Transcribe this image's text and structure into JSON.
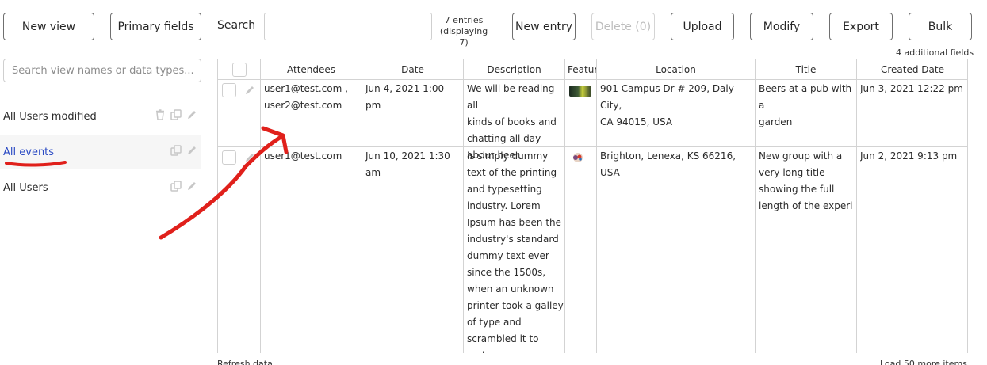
{
  "toolbar": {
    "new_view": "New view",
    "primary_fields": "Primary fields",
    "search_label": "Search",
    "search_value": "",
    "entries_line1": "7 entries",
    "entries_line2": "(displaying 7)",
    "new_entry": "New entry",
    "delete": "Delete (0)",
    "upload": "Upload",
    "modify": "Modify",
    "export": "Export",
    "bulk": "Bulk"
  },
  "sidebar": {
    "search_placeholder": "Search view names or data types...",
    "views": [
      {
        "label": "All Users modified",
        "icons": [
          "trash-icon",
          "copy-icon",
          "pencil-icon"
        ]
      },
      {
        "label": "All events",
        "icons": [
          "copy-icon",
          "pencil-icon"
        ],
        "active": true
      },
      {
        "label": "All Users",
        "icons": [
          "copy-icon",
          "pencil-icon"
        ]
      }
    ]
  },
  "additional_fields": "4 additional fields",
  "table": {
    "columns": [
      "Attendees",
      "Date",
      "Description",
      "Featur",
      "Location",
      "Title",
      "Created Date"
    ],
    "rows": [
      {
        "attendees": [
          "user1@test.com ,",
          "user2@test.com"
        ],
        "date": "Jun 4, 2021 1:00 pm",
        "description": [
          "We will be reading all",
          "kinds of books and",
          "chatting all day",
          "about beer."
        ],
        "location": [
          "901 Campus Dr # 209, Daly City,",
          "CA 94015, USA"
        ],
        "title": [
          "Beers at a pub with a",
          "garden"
        ],
        "created": "Jun 3, 2021 12:22 pm"
      },
      {
        "attendees": [
          "user1@test.com"
        ],
        "date": "Jun 10, 2021 1:30 am",
        "description": [
          "is simply dummy",
          "text of the printing",
          "and typesetting",
          "industry. Lorem",
          "Ipsum has been the",
          "industry's standard",
          "dummy text ever",
          "since the 1500s,",
          "when an unknown",
          "printer took a galley",
          "of type and",
          "scrambled it to make"
        ],
        "location": [
          "Brighton, Lenexa, KS 66216, USA"
        ],
        "title": [
          "New group with a",
          "very long title",
          "showing the full",
          "length of the experi"
        ],
        "created": "Jun 2, 2021 9:13 pm"
      }
    ]
  },
  "footer": {
    "left": "Refresh data",
    "right": "Load 50 more items"
  },
  "colors": {
    "accent_link": "#2b4bc4",
    "annotation_red": "#e0201b",
    "border": "#d3d3d3"
  }
}
